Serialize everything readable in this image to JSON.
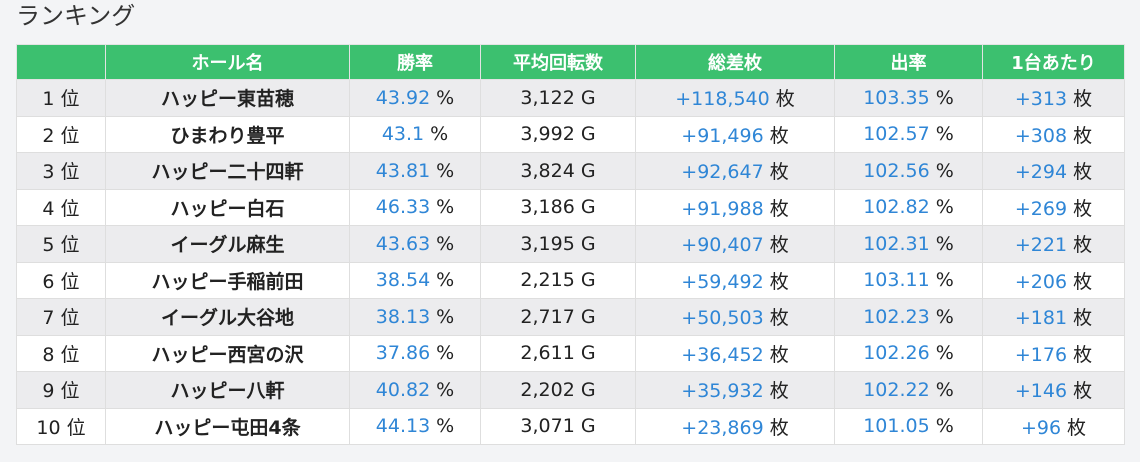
{
  "page": {
    "title": "ランキング"
  },
  "table": {
    "headers": [
      "",
      "ホール名",
      "勝率",
      "平均回転数",
      "総差枚",
      "出率",
      "1台あたり"
    ],
    "units": {
      "win_rate": "%",
      "spins": "G",
      "medals": "枚",
      "payout": "%",
      "per_machine": "枚"
    },
    "rows": [
      {
        "rank": "1 位",
        "hall": "ハッピー東苗穂",
        "win_rate": "43.92",
        "spins": "3,122",
        "medals": "+118,540",
        "payout": "103.35",
        "per_machine": "+313"
      },
      {
        "rank": "2 位",
        "hall": "ひまわり豊平",
        "win_rate": "43.1",
        "spins": "3,992",
        "medals": "+91,496",
        "payout": "102.57",
        "per_machine": "+308"
      },
      {
        "rank": "3 位",
        "hall": "ハッピー二十四軒",
        "win_rate": "43.81",
        "spins": "3,824",
        "medals": "+92,647",
        "payout": "102.56",
        "per_machine": "+294"
      },
      {
        "rank": "4 位",
        "hall": "ハッピー白石",
        "win_rate": "46.33",
        "spins": "3,186",
        "medals": "+91,988",
        "payout": "102.82",
        "per_machine": "+269"
      },
      {
        "rank": "5 位",
        "hall": "イーグル麻生",
        "win_rate": "43.63",
        "spins": "3,195",
        "medals": "+90,407",
        "payout": "102.31",
        "per_machine": "+221"
      },
      {
        "rank": "6 位",
        "hall": "ハッピー手稲前田",
        "win_rate": "38.54",
        "spins": "2,215",
        "medals": "+59,492",
        "payout": "103.11",
        "per_machine": "+206"
      },
      {
        "rank": "7 位",
        "hall": "イーグル大谷地",
        "win_rate": "38.13",
        "spins": "2,717",
        "medals": "+50,503",
        "payout": "102.23",
        "per_machine": "+181"
      },
      {
        "rank": "8 位",
        "hall": "ハッピー西宮の沢",
        "win_rate": "37.86",
        "spins": "2,611",
        "medals": "+36,452",
        "payout": "102.26",
        "per_machine": "+176"
      },
      {
        "rank": "9 位",
        "hall": "ハッピー八軒",
        "win_rate": "40.82",
        "spins": "2,202",
        "medals": "+35,932",
        "payout": "102.22",
        "per_machine": "+146"
      },
      {
        "rank": "10 位",
        "hall": "ハッピー屯田4条",
        "win_rate": "44.13",
        "spins": "3,071",
        "medals": "+23,869",
        "payout": "101.05",
        "per_machine": "+96"
      }
    ]
  },
  "colors": {
    "header_bg": "#3cc06f",
    "header_text": "#ffffff",
    "value_blue": "#2f86d6",
    "row_odd": "#ececee",
    "row_even": "#ffffff",
    "page_bg": "#f3f4f6"
  }
}
